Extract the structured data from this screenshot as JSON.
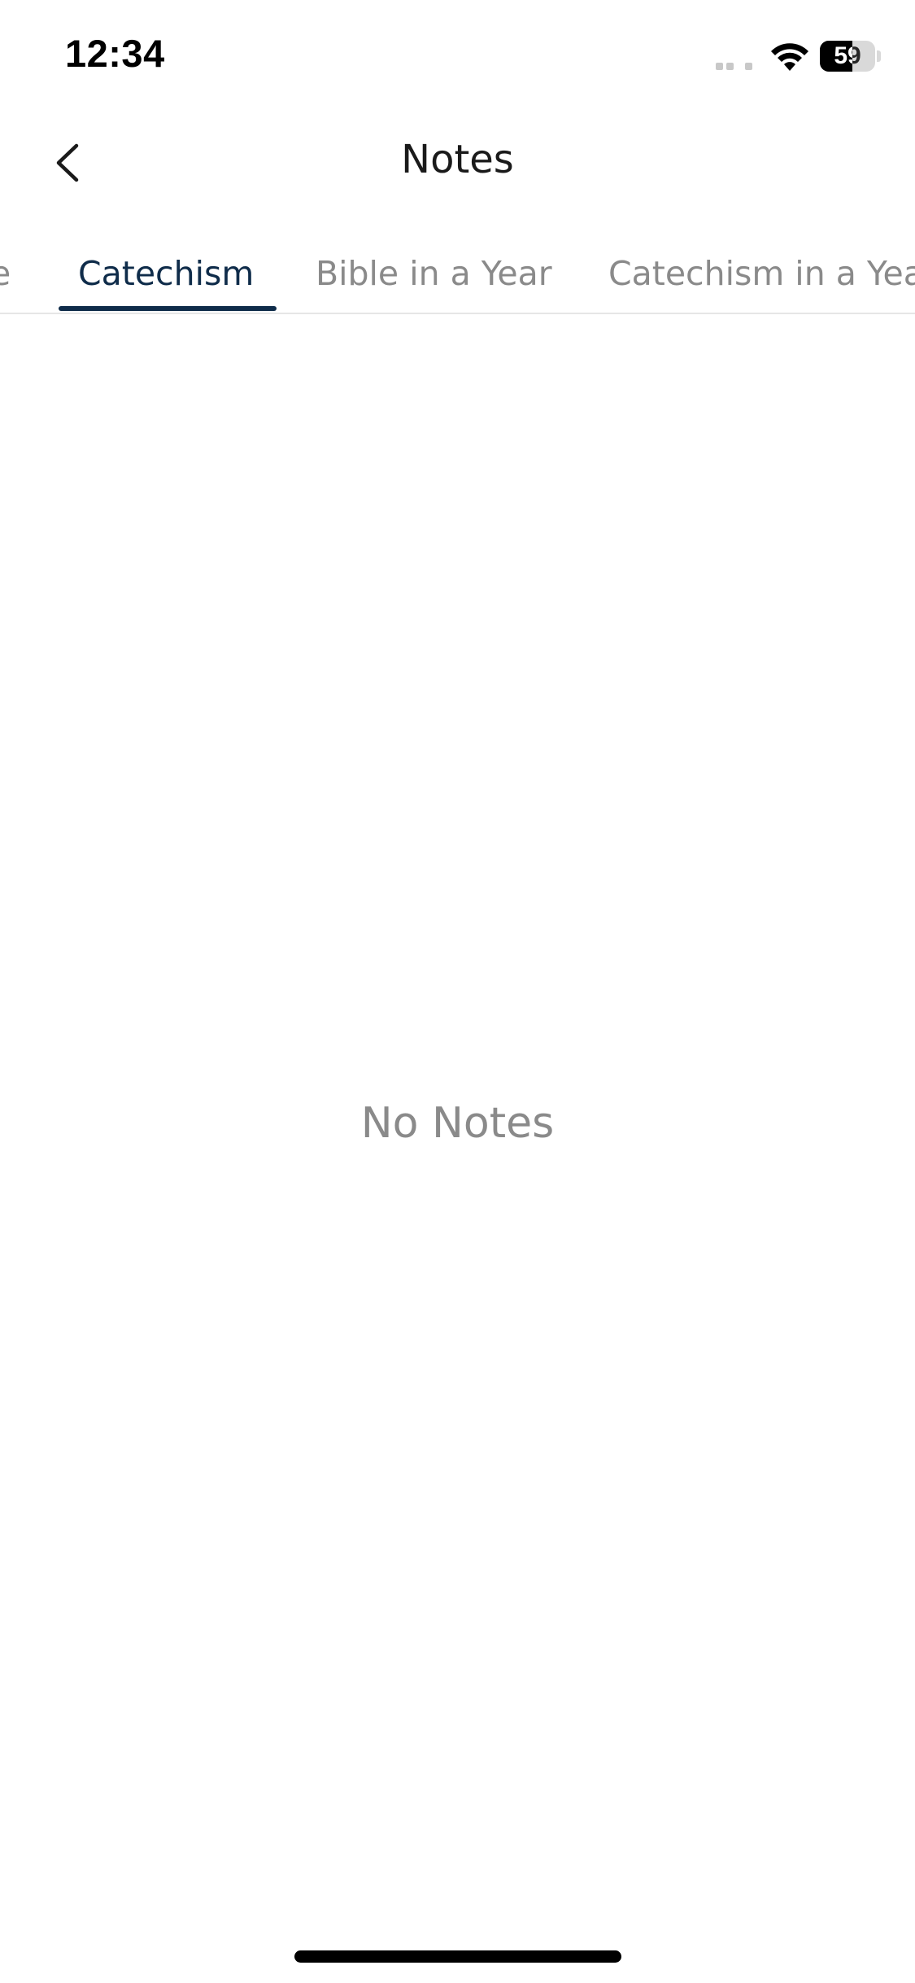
{
  "status_bar": {
    "time": "12:34",
    "battery_level": "59",
    "battery_fraction": 0.59,
    "icons": [
      "cellular-signal-icon",
      "wifi-icon",
      "battery-icon"
    ]
  },
  "nav": {
    "back_icon": "chevron-left-icon",
    "title": "Notes"
  },
  "tabs": [
    {
      "label": "e",
      "active": false
    },
    {
      "label": "Catechism",
      "active": true
    },
    {
      "label": "Bible in a Year",
      "active": false
    },
    {
      "label": "Catechism in a Yea",
      "active": false
    }
  ],
  "empty_state": {
    "message": "No Notes"
  },
  "colors": {
    "accent": "#0f2c4a",
    "inactive_tab": "#8a8a8a",
    "background": "#ffffff"
  }
}
